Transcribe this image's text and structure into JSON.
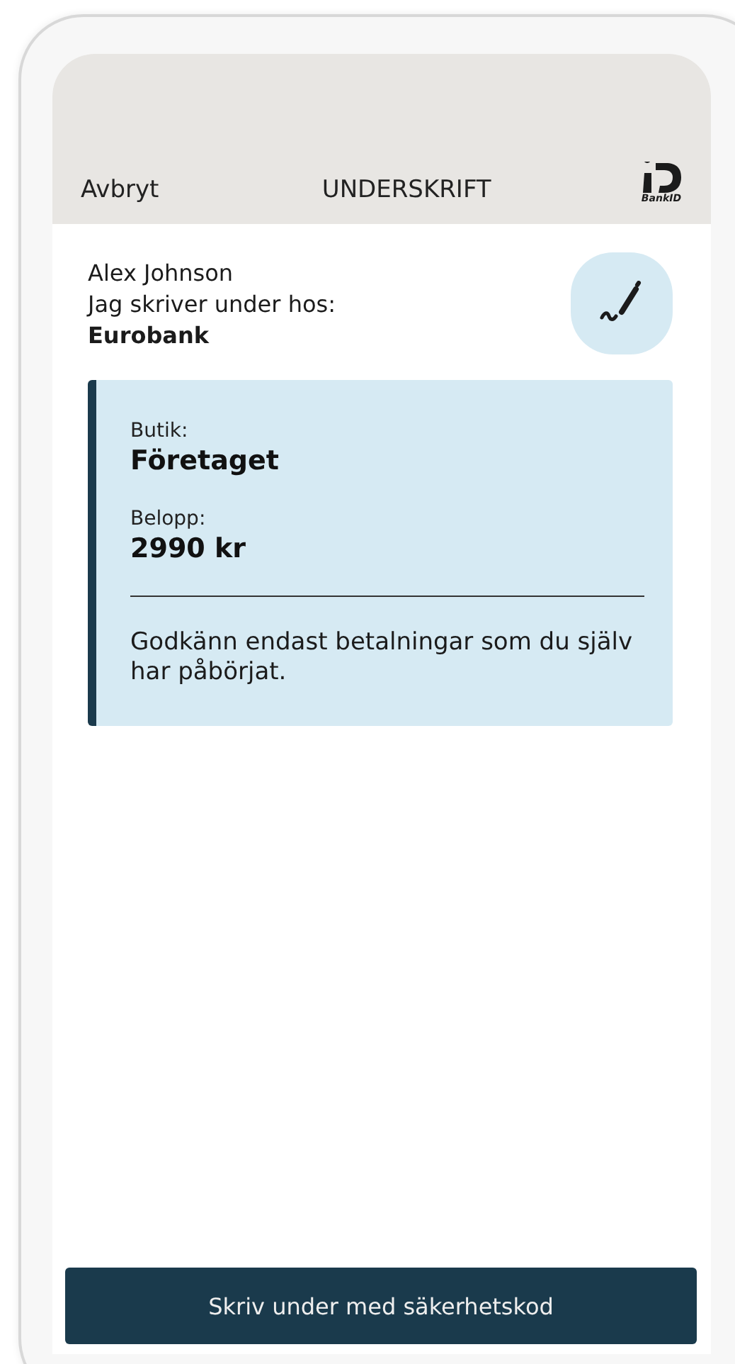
{
  "header": {
    "cancel": "Avbryt",
    "title": "UNDERSKRIFT",
    "logo_text": "BankID"
  },
  "signer": {
    "name": "Alex Johnson",
    "intro": "Jag skriver under hos:",
    "recipient": "Eurobank"
  },
  "details": {
    "fields": [
      {
        "label": "Butik:",
        "value": "Företaget"
      },
      {
        "label": "Belopp:",
        "value": "2990 kr"
      }
    ],
    "notice": "Godkänn endast betalningar som du själv har påbörjat."
  },
  "sign_button": "Skriv under med säkerhetskod"
}
